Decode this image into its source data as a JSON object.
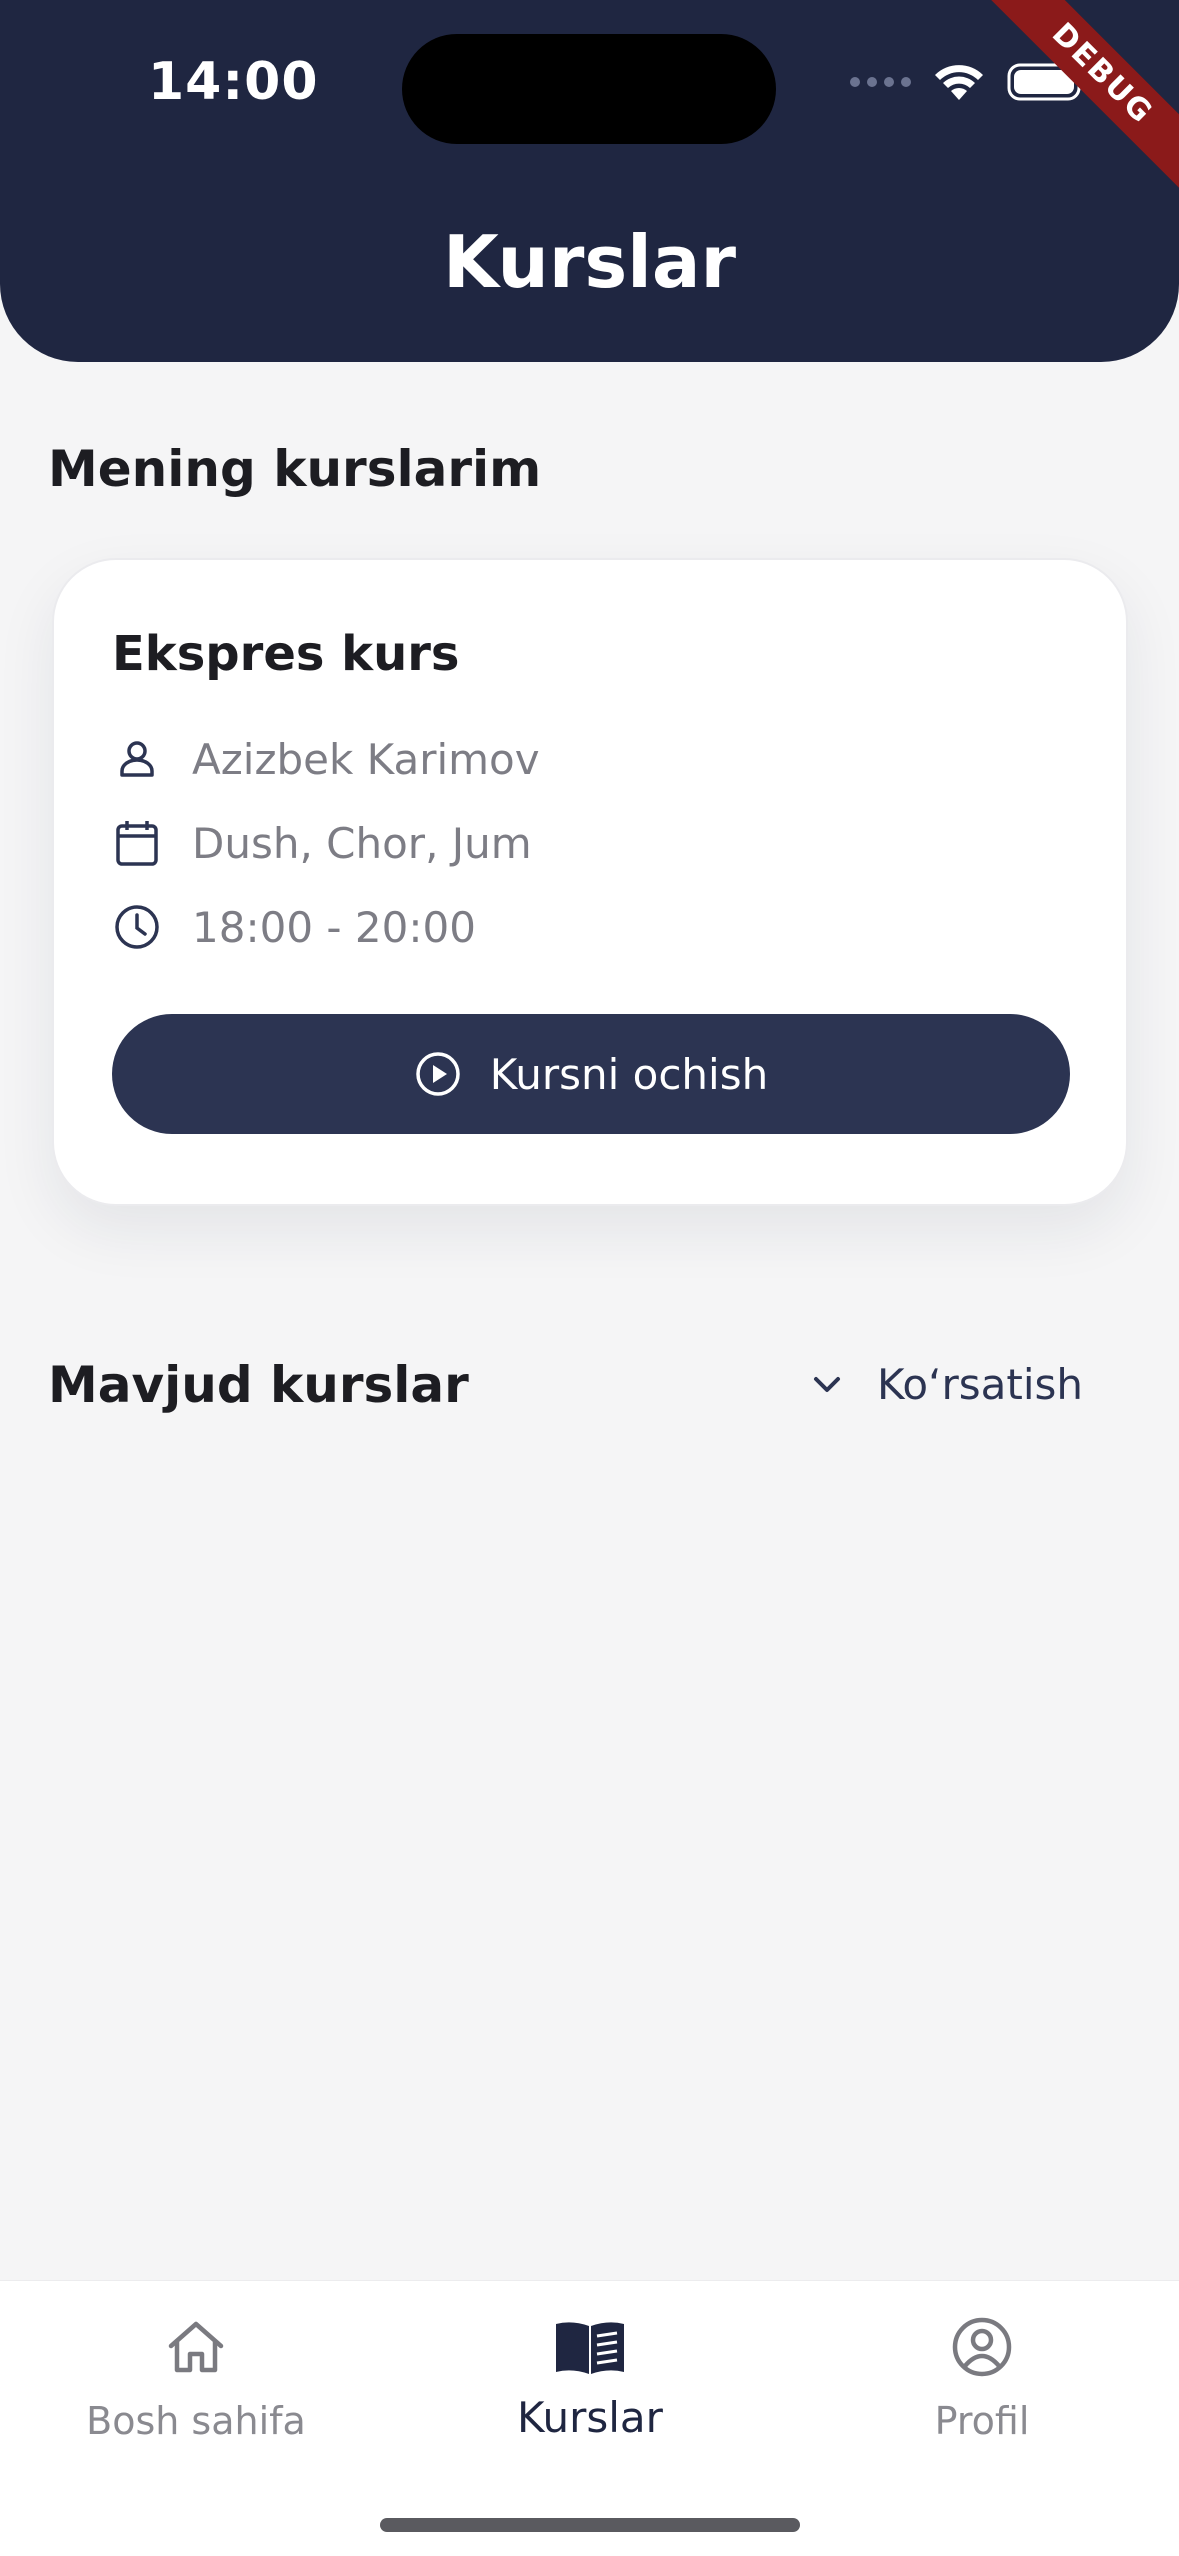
{
  "status_bar": {
    "time": "14:00",
    "debug_label": "DEBUG"
  },
  "header": {
    "title": "Kurslar"
  },
  "my_courses": {
    "section_title": "Mening kurslarim",
    "card": {
      "title": "Ekspres kurs",
      "teacher": "Azizbek Karimov",
      "days": "Dush, Chor, Jum",
      "time": "18:00 - 20:00",
      "open_button_label": "Kursni ochish"
    }
  },
  "available_courses": {
    "section_title": "Mavjud kurslar",
    "toggle_label": "Ko‘rsatish"
  },
  "bottom_nav": {
    "items": [
      {
        "label": "Bosh sahifa",
        "icon": "home-icon",
        "active": false
      },
      {
        "label": "Kurslar",
        "icon": "book-icon",
        "active": true
      },
      {
        "label": "Profil",
        "icon": "profile-icon",
        "active": false
      }
    ]
  },
  "colors": {
    "primary": "#1f2641",
    "button": "#2c3452",
    "background": "#f5f5f6",
    "debug_ribbon": "#8b1a1a",
    "muted_text": "#7d7d85"
  }
}
